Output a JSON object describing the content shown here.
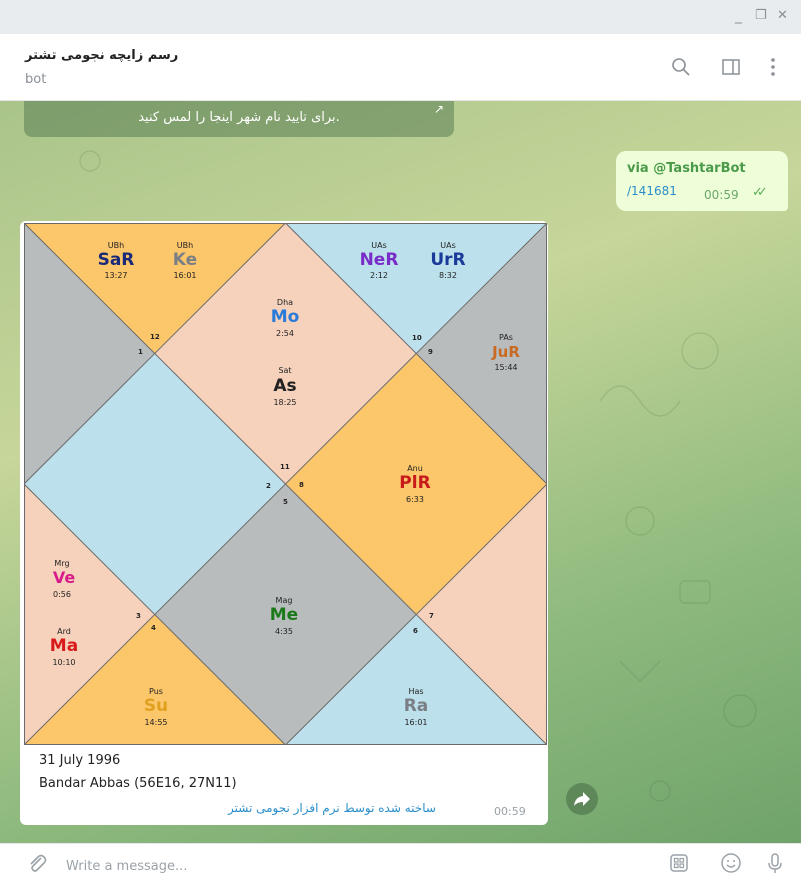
{
  "window": {
    "minimize_glyph": "_",
    "restore_glyph": "❐",
    "close_glyph": "✕"
  },
  "header": {
    "title": "رسم زایچه نجومی تشتر",
    "subtitle": "bot"
  },
  "chat": {
    "inline_button": {
      "label": "برای تایید نام شهر اینجا را لمس کنید.",
      "arrow": "↗"
    },
    "via_message": {
      "line1": "via @TashtarBot",
      "line2": "/141681",
      "time": "00:59",
      "check": "✓✓"
    },
    "photo_message": {
      "caption_date": "31 July 1996",
      "caption_place": "Bandar Abbas (56E16, 27N11)",
      "caption_note": "ساخته شده توسط نرم افزار نجومی تشتر",
      "time": "00:59"
    }
  },
  "chart_houses": [
    {
      "n": "1"
    },
    {
      "n": "2"
    },
    {
      "n": "3"
    },
    {
      "n": "4"
    },
    {
      "n": "5"
    },
    {
      "n": "6"
    },
    {
      "n": "7"
    },
    {
      "n": "8"
    },
    {
      "n": "9"
    },
    {
      "n": "10"
    },
    {
      "n": "11"
    },
    {
      "n": "12"
    }
  ],
  "chart_planets": [
    {
      "nak": "UBh",
      "name": "SaR",
      "deg": "13:27",
      "color": "#1a2a78"
    },
    {
      "nak": "UBh",
      "name": "Ke",
      "deg": "16:01",
      "color": "#7a7f86"
    },
    {
      "nak": "UAs",
      "name": "NeR",
      "deg": "2:12",
      "color": "#7a2cc8"
    },
    {
      "nak": "UAs",
      "name": "UrR",
      "deg": "8:32",
      "color": "#1a3a9a"
    },
    {
      "nak": "Dha",
      "name": "Mo",
      "deg": "2:54",
      "color": "#2a7ad8"
    },
    {
      "nak": "Sat",
      "name": "As",
      "deg": "18:25",
      "color": "#222222"
    },
    {
      "nak": "PAs",
      "name": "JuR",
      "deg": "15:44",
      "color": "#c86a22"
    },
    {
      "nak": "Anu",
      "name": "PlR",
      "deg": "6:33",
      "color": "#c81a1a"
    },
    {
      "nak": "Mrg",
      "name": "Ve",
      "deg": "0:56",
      "color": "#d81a8a"
    },
    {
      "nak": "Ard",
      "name": "Ma",
      "deg": "10:10",
      "color": "#d81a1a"
    },
    {
      "nak": "Mag",
      "name": "Me",
      "deg": "4:35",
      "color": "#1a7a1a"
    },
    {
      "nak": "Pus",
      "name": "Su",
      "deg": "14:55",
      "color": "#e0a020"
    },
    {
      "nak": "Has",
      "name": "Ra",
      "deg": "16:01",
      "color": "#7a7f86"
    }
  ],
  "composer": {
    "placeholder": "Write a message..."
  },
  "colors": {
    "orange": "#fcc66a",
    "peach": "#f6d2bc",
    "blue": "#bde1ec",
    "gray": "#b9bcbd"
  }
}
